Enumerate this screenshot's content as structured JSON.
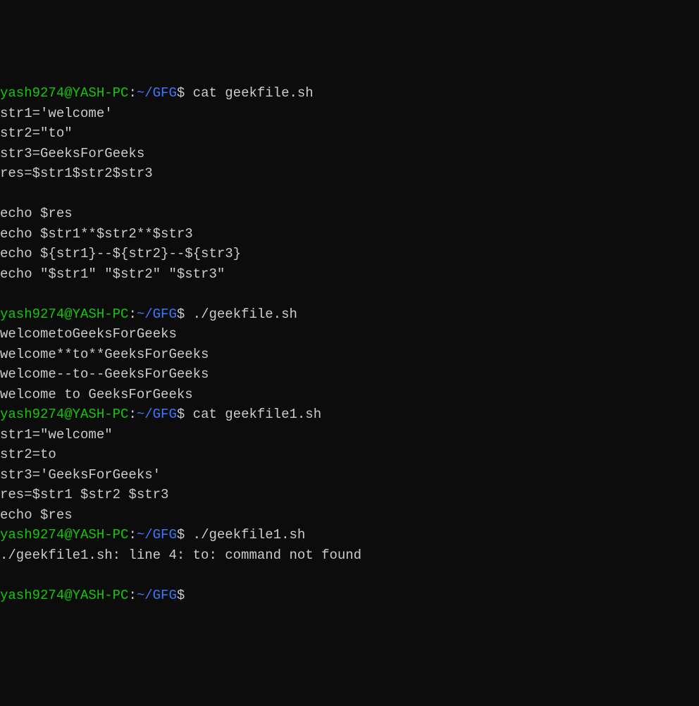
{
  "prompt": {
    "user": "yash9274@YASH-PC",
    "colon": ":",
    "path": "~/GFG",
    "dollar": "$"
  },
  "lines": [
    {
      "type": "prompt",
      "cmd": " cat geekfile.sh"
    },
    {
      "type": "output",
      "text": "str1='welcome'"
    },
    {
      "type": "output",
      "text": "str2=\"to\""
    },
    {
      "type": "output",
      "text": "str3=GeeksForGeeks"
    },
    {
      "type": "output",
      "text": "res=$str1$str2$str3"
    },
    {
      "type": "output",
      "text": ""
    },
    {
      "type": "output",
      "text": "echo $res"
    },
    {
      "type": "output",
      "text": "echo $str1**$str2**$str3"
    },
    {
      "type": "output",
      "text": "echo ${str1}--${str2}--${str3}"
    },
    {
      "type": "output",
      "text": "echo \"$str1\" \"$str2\" \"$str3\""
    },
    {
      "type": "output",
      "text": ""
    },
    {
      "type": "prompt",
      "cmd": " ./geekfile.sh"
    },
    {
      "type": "output",
      "text": "welcometoGeeksForGeeks"
    },
    {
      "type": "output",
      "text": "welcome**to**GeeksForGeeks"
    },
    {
      "type": "output",
      "text": "welcome--to--GeeksForGeeks"
    },
    {
      "type": "output",
      "text": "welcome to GeeksForGeeks"
    },
    {
      "type": "prompt",
      "cmd": " cat geekfile1.sh"
    },
    {
      "type": "output",
      "text": "str1=\"welcome\""
    },
    {
      "type": "output",
      "text": "str2=to"
    },
    {
      "type": "output",
      "text": "str3='GeeksForGeeks'"
    },
    {
      "type": "output",
      "text": "res=$str1 $str2 $str3"
    },
    {
      "type": "output",
      "text": "echo $res"
    },
    {
      "type": "prompt",
      "cmd": " ./geekfile1.sh"
    },
    {
      "type": "output",
      "text": "./geekfile1.sh: line 4: to: command not found"
    },
    {
      "type": "output",
      "text": ""
    },
    {
      "type": "prompt",
      "cmd": ""
    }
  ]
}
